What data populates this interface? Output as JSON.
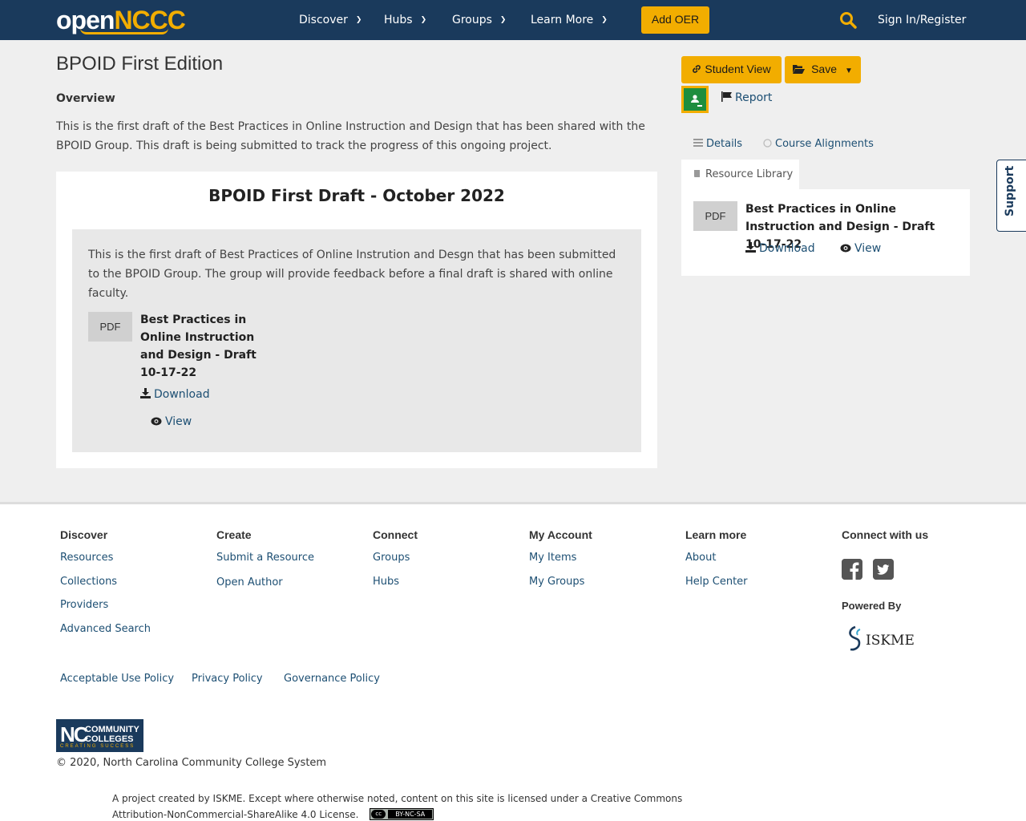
{
  "header": {
    "logo_open": "open",
    "logo_nccc": "NCCC",
    "nav": [
      "Discover",
      "Hubs",
      "Groups",
      "Learn More"
    ],
    "add_oer": "Add OER",
    "sign_in": "Sign In/Register"
  },
  "resource": {
    "title": "BPOID First Edition",
    "overview_heading": "Overview",
    "overview_text": "This is the first draft of the Best Practices in Online Instruction and Design that has been shared with the BPOID Group.  This draft is being submitted to track the progress of this ongoing project.",
    "section_title": "BPOID First Draft - October 2022",
    "section_text": "This is the first draft of Best Practices of Online Instrution and Desgn that has been submitted to the BPOID Group.  The group will provide feedback before a final draft is shared with online faculty.",
    "file_badge": "PDF",
    "file_title": "Best Practices in Online Instruction and Design - Draft 10-17-22",
    "download": "Download",
    "view": "View"
  },
  "sidebar": {
    "student_view": "Student View",
    "save": "Save",
    "report": "Report",
    "tabs": [
      "Details",
      "Course Alignments",
      "Resource Library"
    ],
    "library_badge": "PDF",
    "library_title": "Best Practices in Online Instruction and Design - Draft 10-17-22",
    "download": "Download",
    "view": "View"
  },
  "support": "Support",
  "footer": {
    "columns": [
      {
        "heading": "Discover",
        "links": [
          "Resources",
          "Collections",
          "Providers",
          "Advanced Search"
        ]
      },
      {
        "heading": "Create",
        "links": [
          "Submit a Resource",
          "Open Author"
        ]
      },
      {
        "heading": "Connect",
        "links": [
          "Groups",
          "Hubs"
        ]
      },
      {
        "heading": "My Account",
        "links": [
          "My Items",
          "My Groups"
        ]
      },
      {
        "heading": "Learn more",
        "links": [
          "About",
          "Help Center"
        ]
      },
      {
        "heading": "Connect with us",
        "links": []
      }
    ],
    "powered_by": "Powered By",
    "iskme": "ISKME",
    "policies": [
      "Acceptable Use Policy",
      "Privacy Policy",
      "Governance Policy"
    ],
    "nccc_logo_nc": "NC",
    "nccc_logo_line1": "COMMUNITY",
    "nccc_logo_line2": "COLLEGES",
    "nccc_logo_tag": "CREATING SUCCESS",
    "copyright": "© 2020, North Carolina Community College System",
    "license_text": "A project created by ISKME. Except where otherwise noted, content on this site is licensed under a Creative Commons Attribution-NonCommercial-ShareAlike 4.0 License.",
    "cc_left": "cc",
    "cc_right": "BY-NC-SA"
  },
  "colors": {
    "navy": "#1a3a5c",
    "gold": "#f2ad00",
    "link": "#1d4f73"
  }
}
